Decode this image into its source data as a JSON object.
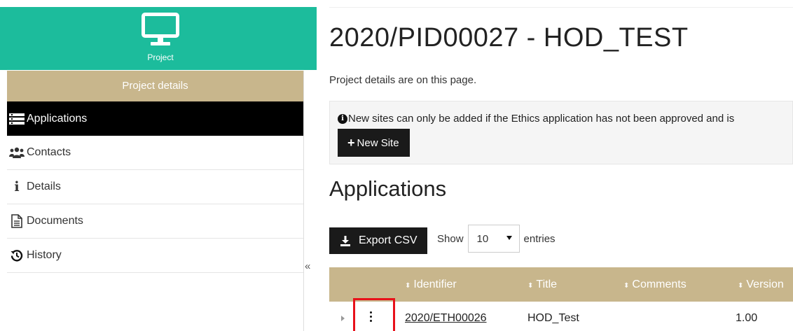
{
  "sidebar": {
    "brand_label": "Project",
    "section_title": "Project details",
    "items": [
      {
        "label": "Applications",
        "icon": "applications-icon",
        "active": true
      },
      {
        "label": "Contacts",
        "icon": "contacts-icon"
      },
      {
        "label": "Details",
        "icon": "info-icon"
      },
      {
        "label": "Documents",
        "icon": "document-icon"
      },
      {
        "label": "History",
        "icon": "history-icon"
      }
    ],
    "collapse_label": "«"
  },
  "main": {
    "title": "2020/PID00027 - HOD_TEST",
    "intro": "Project details are on this page.",
    "alert_text": "New sites can only be added if the Ethics application has not been approved and is",
    "new_site_label": "New Site",
    "applications_heading": "Applications",
    "export_label": "Export CSV",
    "show_label": "Show",
    "entries_value": "10",
    "entries_label": "entries",
    "table": {
      "headers": [
        "Identifier",
        "Title",
        "Comments",
        "Version"
      ],
      "rows": [
        {
          "identifier": "2020/ETH00026",
          "title": "HOD_Test",
          "comments": "",
          "version": "1.00"
        }
      ]
    }
  },
  "colors": {
    "brand_teal": "#1cbc9c",
    "tan": "#c8b68c",
    "active_black": "#000000",
    "highlight_red": "#e8111a"
  }
}
